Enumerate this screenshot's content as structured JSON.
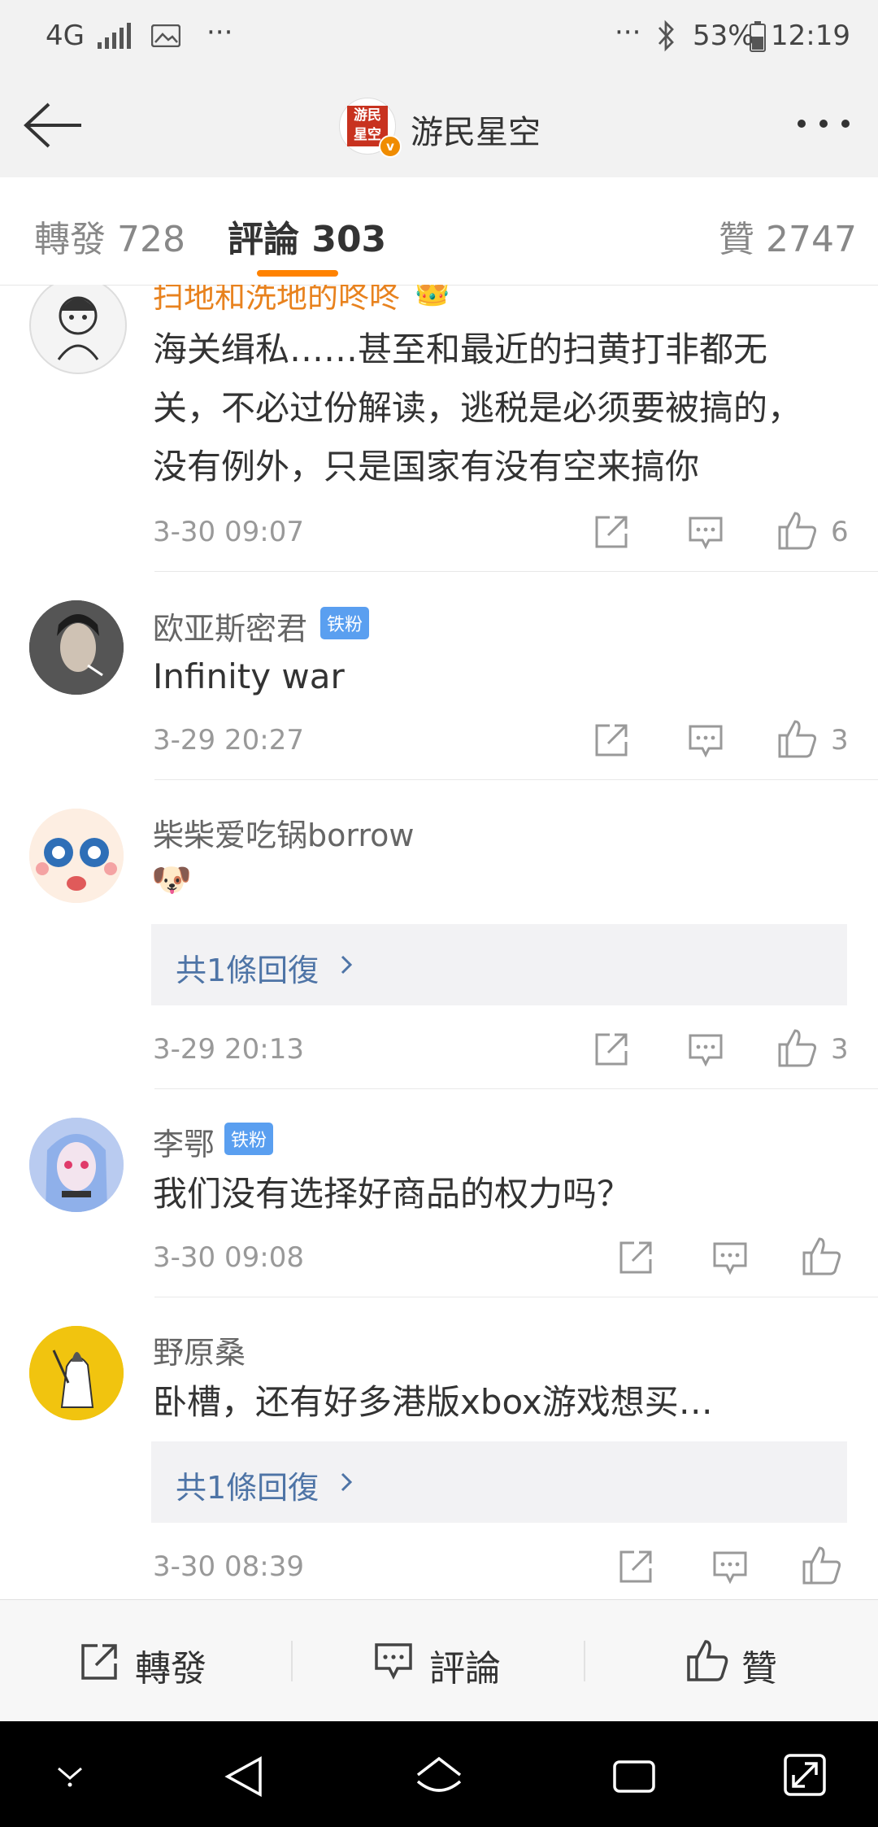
{
  "status_bar": {
    "network": "4G",
    "ellipsis_left": "···",
    "ellipsis_right": "···",
    "battery": "53%",
    "time": "12:19"
  },
  "nav": {
    "title": "游民星空",
    "logo_text": "游民星空"
  },
  "tabs": {
    "repost_label": "轉發",
    "repost_count": "728",
    "comment_label": "評論",
    "comment_count": "303",
    "like_label": "贊",
    "like_count": "2747"
  },
  "comments": [
    {
      "user": "扫地和洗地的咚咚",
      "lines": [
        "海关缉私……甚至和最近的扫黄打非都无",
        "关，不必过份解读，逃税是必须要被搞的，",
        "没有例外，只是国家有没有空来搞你"
      ],
      "time": "3-30 09:07",
      "likes": "6"
    },
    {
      "user": "欧亚斯密君",
      "badge": "铁粉",
      "text": "Infinity war",
      "time": "3-29 20:27",
      "likes": "3"
    },
    {
      "user": "柴柴爱吃锅borrow",
      "emoji": "🐶",
      "reply": "共1條回復",
      "time": "3-29 20:13",
      "likes": "3"
    },
    {
      "user": "李鄂",
      "badge": "铁粉",
      "text": "我们没有选择好商品的权力吗？",
      "time": "3-30 09:08"
    },
    {
      "user": "野原桑",
      "text": "卧槽，还有好多港版xbox游戏想买…",
      "reply": "共1條回復",
      "time": "3-30 08:39"
    }
  ],
  "bottom_bar": {
    "repost": "轉發",
    "comment": "評論",
    "like": "贊"
  },
  "colors": {
    "accent": "#ff8200",
    "reply_link": "#4e74a6",
    "fan_badge": "#5a9ff0",
    "username_highlight": "#e8821e"
  }
}
